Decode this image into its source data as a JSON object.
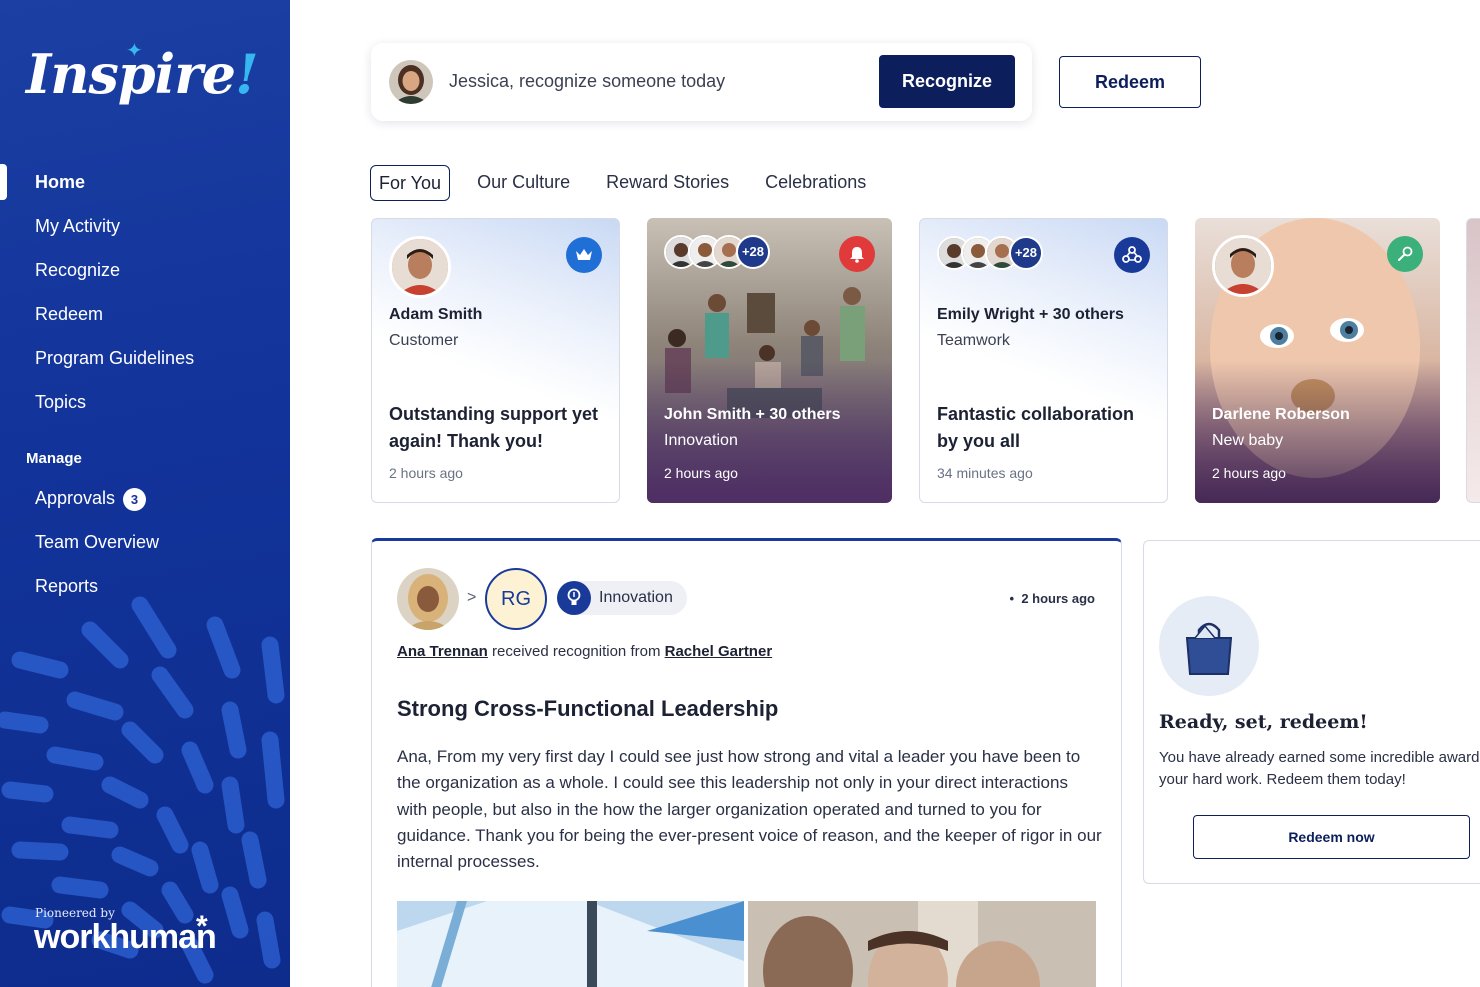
{
  "brand": {
    "logo_text": "Inspire",
    "logo_bang": "!",
    "footer_prefix": "Pioneered by",
    "footer_brand": "workhuman",
    "accent": "#1a3a9a",
    "dark_navy": "#0c1f5c"
  },
  "sidebar": {
    "items": [
      {
        "label": "Home",
        "active": true
      },
      {
        "label": "My Activity"
      },
      {
        "label": "Recognize"
      },
      {
        "label": "Redeem"
      },
      {
        "label": "Program Guidelines"
      },
      {
        "label": "Topics"
      }
    ],
    "manage_title": "Manage",
    "manage_items": [
      {
        "label": "Approvals",
        "badge": "3"
      },
      {
        "label": "Team Overview"
      },
      {
        "label": "Reports"
      }
    ]
  },
  "topbar": {
    "prompt": "Jessica, recognize someone today",
    "recognize_label": "Recognize",
    "redeem_label": "Redeem"
  },
  "tabs": [
    {
      "label": "For You",
      "active": true
    },
    {
      "label": "Our Culture"
    },
    {
      "label": "Reward Stories"
    },
    {
      "label": "Celebrations"
    }
  ],
  "cards": [
    {
      "name": "Adam Smith",
      "sub": "Customer",
      "message": "Outstanding support yet again! Thank you!",
      "time": "2 hours ago",
      "icon": "crown-icon"
    },
    {
      "name": "John Smith + 30 others",
      "sub": "Innovation",
      "time": "2 hours ago",
      "more": "+28",
      "icon": "bell-icon"
    },
    {
      "name": "Emily Wright + 30 others",
      "sub": "Teamwork",
      "message": "Fantastic collaboration by you all",
      "time": "34 minutes ago",
      "more": "+28",
      "icon": "team-icon"
    },
    {
      "name": "Darlene Roberson",
      "sub": "New baby",
      "time": "2 hours ago",
      "icon": "rattle-icon"
    }
  ],
  "post": {
    "initials": "RG",
    "tag": "Innovation",
    "time": "2 hours ago",
    "recipient": "Ana Trennan",
    "middle": " received recognition from ",
    "giver": "Rachel Gartner",
    "title": "Strong Cross-Functional Leadership",
    "body": "Ana, From my very first day I could see just how strong and vital a leader you have been to the organization as a whole.  I could see this leadership not only in your direct interactions with people, but also in the how the larger organization operated and turned to you for guidance. Thank you for being the ever-present voice of reason, and the keeper of rigor in our internal processes."
  },
  "redeem_card": {
    "title": "Ready, set, redeem!",
    "text": "You have already earned some incredible awards your hard work. Redeem them today!",
    "button": "Redeem now"
  }
}
